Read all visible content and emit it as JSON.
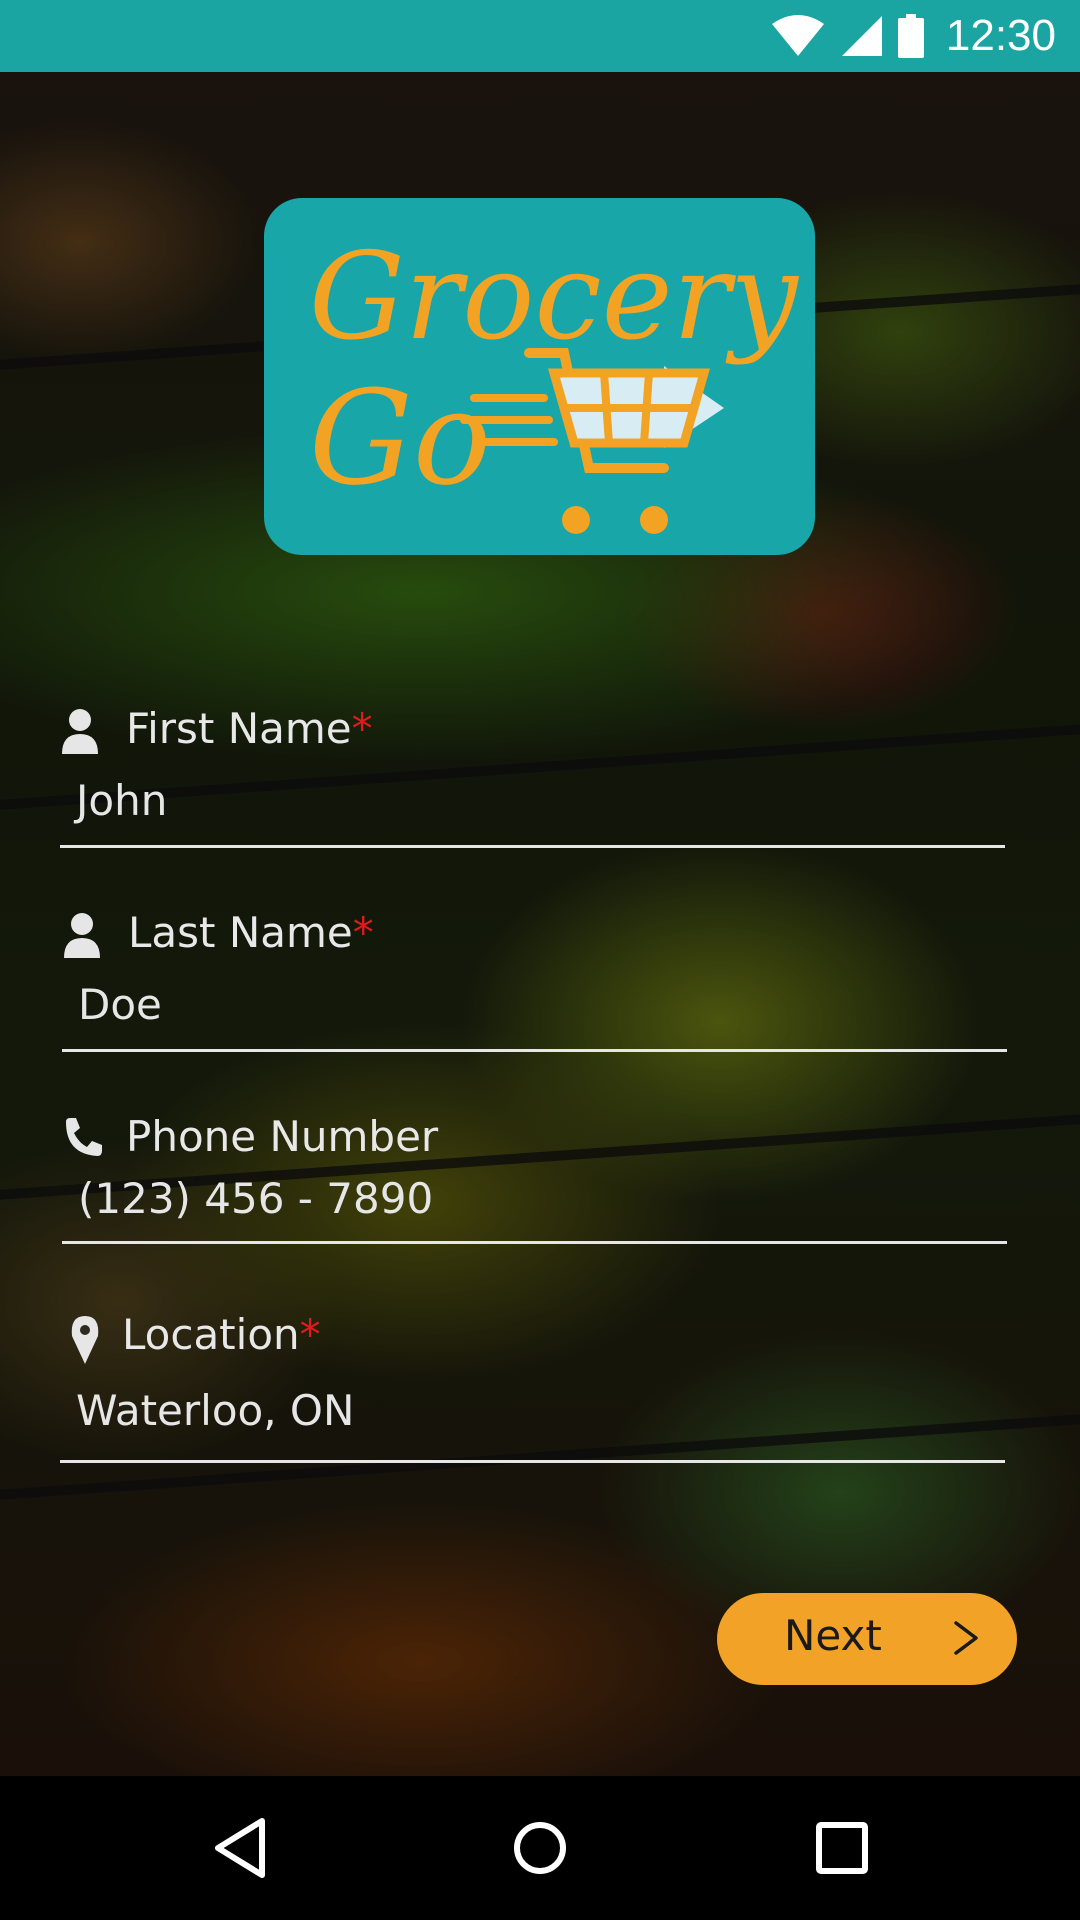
{
  "status_bar": {
    "time": "12:30",
    "icons": [
      "wifi-icon",
      "signal-icon",
      "battery-icon"
    ],
    "color": "#1aa5a3"
  },
  "logo": {
    "line1": "Grocery",
    "line2": "Go",
    "background": "#18a6a9",
    "accent": "#f2a324"
  },
  "form": {
    "first_name": {
      "label": "First Name",
      "required_mark": "*",
      "value": "John",
      "icon": "person-icon"
    },
    "last_name": {
      "label": "Last Name",
      "required_mark": "*",
      "value": "Doe",
      "icon": "person-icon"
    },
    "phone": {
      "label": "Phone Number",
      "value": "(123) 456 - 7890",
      "icon": "phone-icon"
    },
    "location": {
      "label": "Location",
      "required_mark": "*",
      "value": "Waterloo, ON",
      "icon": "location-pin-icon"
    }
  },
  "next_button": {
    "label": "Next",
    "chevron": ">",
    "color": "#f2a327"
  },
  "nav_bar": {
    "buttons": [
      "back-icon",
      "home-icon",
      "recents-icon"
    ]
  }
}
